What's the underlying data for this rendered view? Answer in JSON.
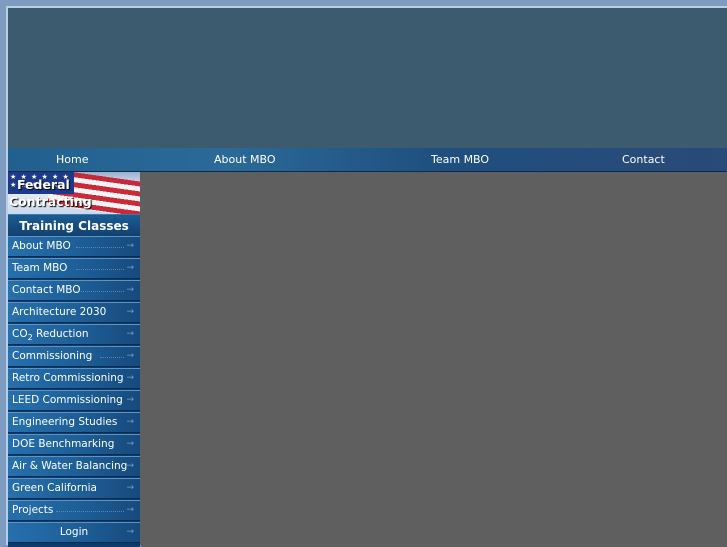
{
  "colors": {
    "page_bg": "#7d9cc0",
    "banner": "#3d5b6e",
    "content": "#5f5f5f",
    "sidebar": "#0d3b69"
  },
  "topnav": {
    "items": [
      "Home",
      "About MBO",
      "Team MBO",
      "Contact"
    ]
  },
  "sidebar": {
    "flag_title_line1": "Federal",
    "flag_title_line2": "Contracting",
    "section_title": "Training Classes",
    "items": [
      "About MBO",
      "Team MBO",
      "Contact MBO",
      "Architecture 2030",
      "CO",
      "Commissioning",
      "Retro Commissioning",
      "LEED Commissioning",
      "Engineering Studies",
      "DOE Benchmarking",
      "Air & Water Balancing",
      "Green California",
      "Projects",
      "Login"
    ],
    "co2_subscript": "2",
    "co2_suffix": " Reduction"
  }
}
